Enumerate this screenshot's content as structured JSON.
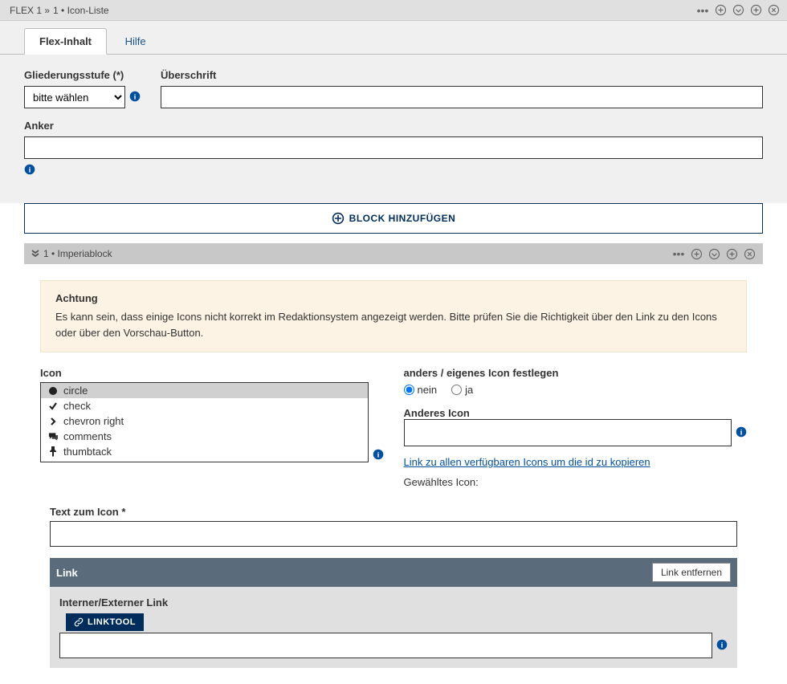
{
  "topbar": {
    "breadcrumb": [
      "FLEX 1 »",
      "1 • Icon-Liste"
    ]
  },
  "tabs": {
    "active": "Flex-Inhalt",
    "inactive": "Hilfe"
  },
  "form": {
    "gliederung_label": "Gliederungsstufe (*)",
    "gliederung_value": "bitte wählen",
    "ueberschrift_label": "Überschrift",
    "ueberschrift_value": "",
    "anker_label": "Anker",
    "anker_value": ""
  },
  "add_block_label": "BLOCK HINZUFÜGEN",
  "subpanel": {
    "title": "1 • Imperiablock"
  },
  "warning": {
    "title": "Achtung",
    "text": "Es kann sein, dass einige Icons nicht korrekt im Redaktionsystem angezeigt werden. Bitte prüfen Sie die Richtigkeit über den Link zu den Icons oder über den Vorschau-Button."
  },
  "icon_section": {
    "label": "Icon",
    "items": [
      {
        "glyph": "circle",
        "label": "circle",
        "selected": true
      },
      {
        "glyph": "check",
        "label": "check",
        "selected": false
      },
      {
        "glyph": "chevron-right",
        "label": "chevron right",
        "selected": false
      },
      {
        "glyph": "comments",
        "label": "comments",
        "selected": false
      },
      {
        "glyph": "thumbtack",
        "label": "thumbtack",
        "selected": false
      }
    ],
    "custom_label": "anders / eigenes Icon festlegen",
    "radio_nein": "nein",
    "radio_ja": "ja",
    "anderes_icon_label": "Anderes Icon",
    "anderes_icon_value": "",
    "icons_link": "Link zu allen verfügbaren Icons um die id zu kopieren",
    "gewaehltes_label": "Gewähltes Icon:"
  },
  "text_icon": {
    "label": "Text zum Icon *",
    "value": ""
  },
  "linkbox": {
    "header": "Link",
    "remove": "Link entfernen",
    "intext_label": "Interner/Externer Link",
    "linktool": "LINKTOOL",
    "value": ""
  }
}
